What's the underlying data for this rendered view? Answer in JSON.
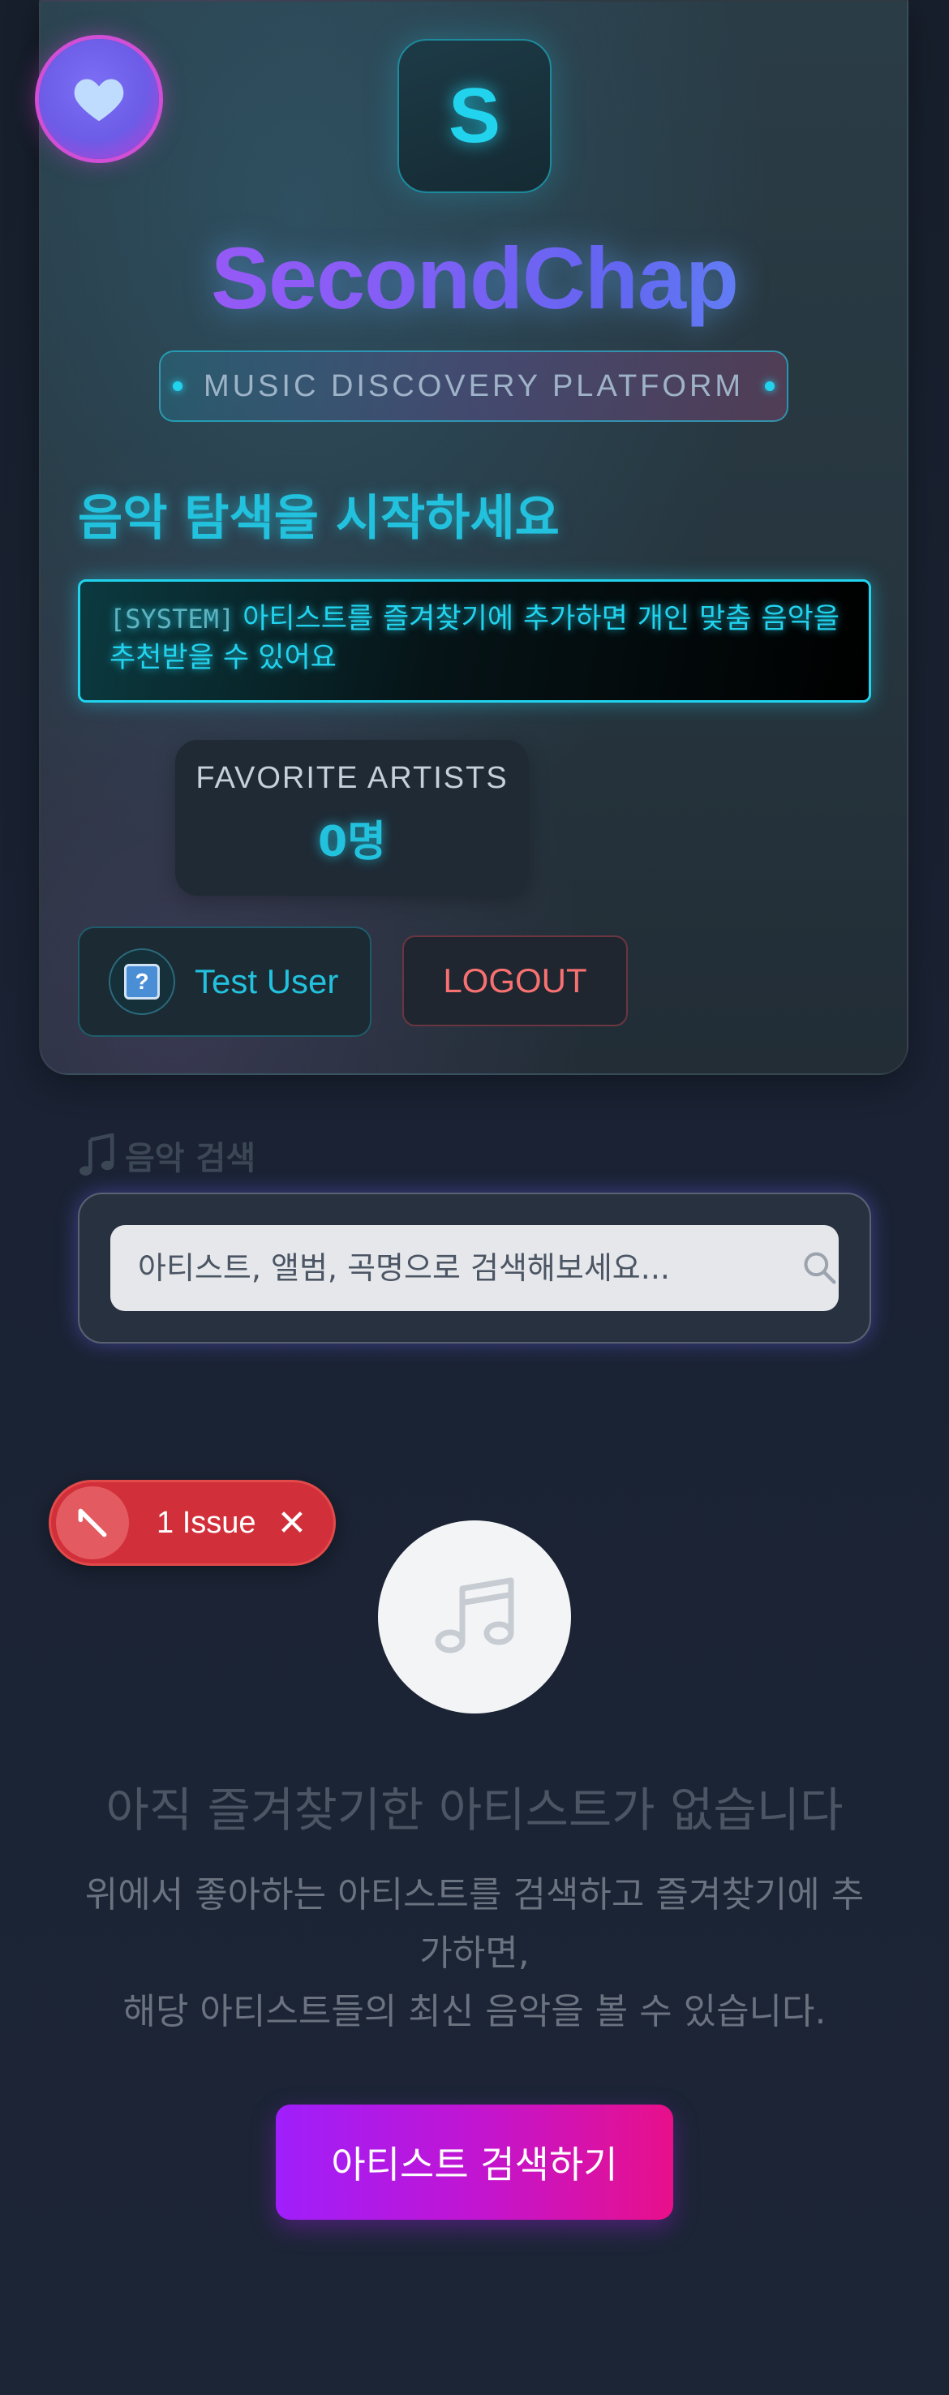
{
  "header": {
    "logo_letter": "S",
    "brand_name": "SecondChap",
    "tagline": "MUSIC DISCOVERY PLATFORM",
    "start_heading": "음악 탐색을 시작하세요",
    "system_tag": "[SYSTEM]",
    "system_message": "아티스트를 즐겨찾기에 추가하면 개인 맞춤 음악을 추천받을 수 있어요",
    "favorite_artists": {
      "label": "FAVORITE ARTISTS",
      "value": "0명"
    },
    "user": {
      "name": "Test User",
      "avatar_glyph": "?"
    },
    "logout_label": "LOGOUT"
  },
  "search": {
    "title": "음악 검색",
    "placeholder": "아티스트, 앨범, 곡명으로 검색해보세요..."
  },
  "issue_badge": {
    "label": "1 Issue"
  },
  "empty_state": {
    "title": "아직 즐겨찾기한 아티스트가 없습니다",
    "description_line1": "위에서 좋아하는 아티스트를 검색하고 즐겨찾기에 추가하면,",
    "description_line2": "해당 아티스트들의 최신 음악을 볼 수 있습니다.",
    "button_label": "아티스트 검색하기"
  },
  "colors": {
    "accent_cyan": "#22d3ee",
    "brand_purple": "#8b5cf6",
    "danger": "#f87171",
    "cta_start": "#9f1ffb",
    "cta_end": "#e8108a"
  },
  "icons": [
    "heart-icon",
    "music-note-icon",
    "search-icon",
    "close-icon",
    "issue-logo-icon"
  ]
}
